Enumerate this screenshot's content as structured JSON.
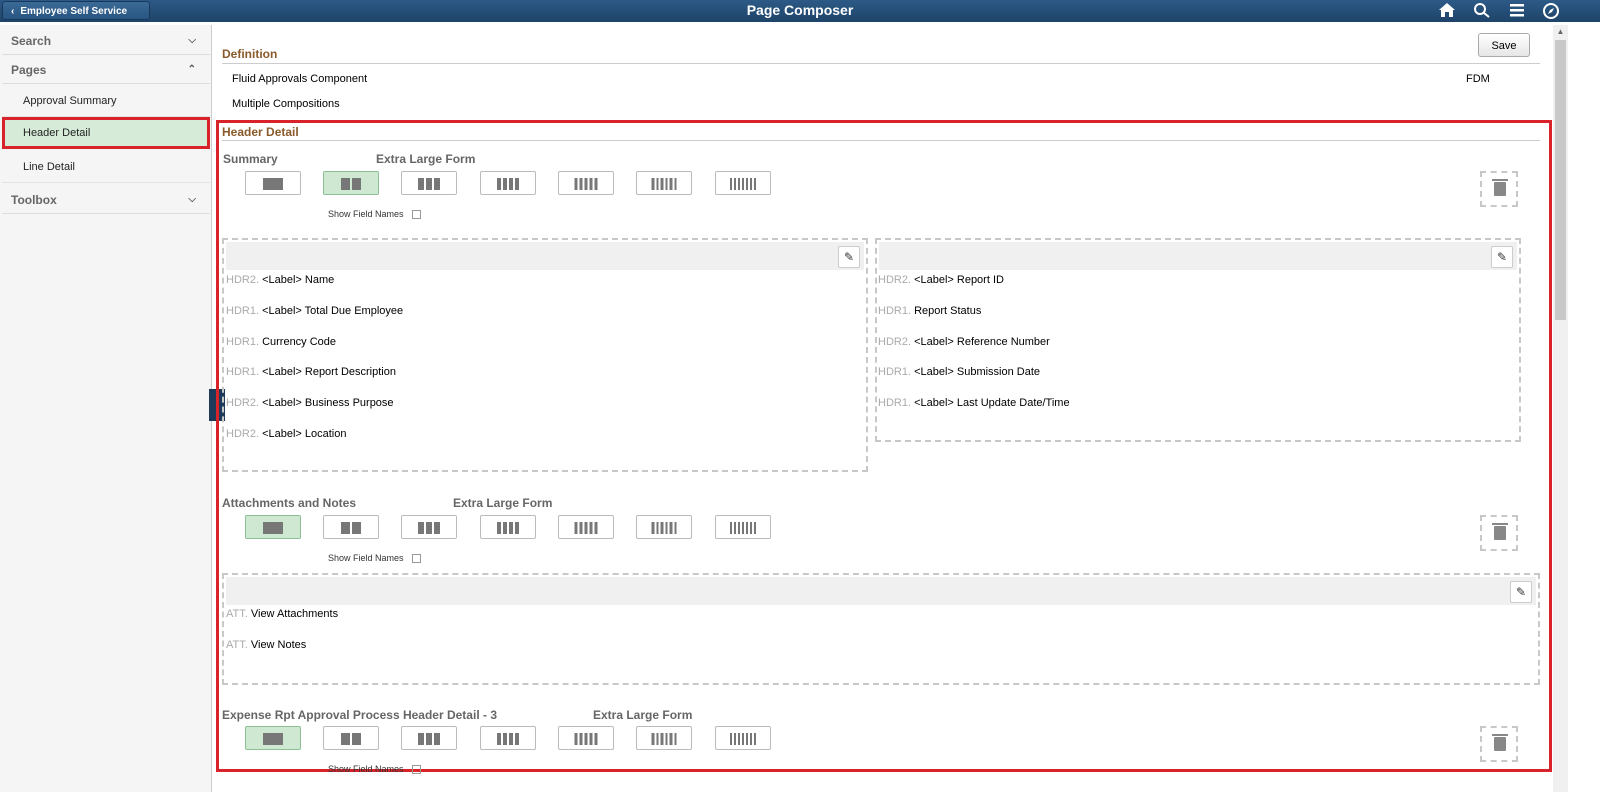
{
  "header": {
    "back_label": "Employee Self Service",
    "title": "Page Composer",
    "icons": [
      "home-icon",
      "search-icon",
      "menu-icon",
      "navigator-icon"
    ]
  },
  "sidebar": {
    "search_label": "Search",
    "pages_label": "Pages",
    "items": [
      {
        "label": "Approval Summary",
        "selected": false
      },
      {
        "label": "Header Detail",
        "selected": true
      },
      {
        "label": "Line Detail",
        "selected": false
      }
    ],
    "toolbox_label": "Toolbox"
  },
  "definition": {
    "title": "Definition",
    "component": "Fluid Approvals Component",
    "compositions": "Multiple Compositions",
    "code": "FDM",
    "save_label": "Save"
  },
  "header_detail": {
    "title": "Header Detail",
    "groups": [
      {
        "label": "Summary",
        "form_label": "Extra Large Form",
        "selected_layout": 2,
        "show_field_names": "Show Field Names",
        "columns": [
          {
            "fields": [
              {
                "prefix": "HDR2.",
                "text": "<Label> Name"
              },
              {
                "prefix": "HDR1.",
                "text": "<Label> Total Due Employee"
              },
              {
                "prefix": "HDR1.",
                "text": "Currency Code"
              },
              {
                "prefix": "HDR1.",
                "text": "<Label> Report Description"
              },
              {
                "prefix": "HDR2.",
                "text": "<Label> Business Purpose"
              },
              {
                "prefix": "HDR2.",
                "text": "<Label> Location"
              }
            ]
          },
          {
            "fields": [
              {
                "prefix": "HDR2.",
                "text": "<Label> Report ID"
              },
              {
                "prefix": "HDR1.",
                "text": "Report Status"
              },
              {
                "prefix": "HDR2.",
                "text": "<Label> Reference Number"
              },
              {
                "prefix": "HDR1.",
                "text": "<Label> Submission Date"
              },
              {
                "prefix": "HDR1.",
                "text": "<Label> Last Update Date/Time"
              }
            ]
          }
        ]
      },
      {
        "label": "Attachments and Notes",
        "form_label": "Extra Large Form",
        "selected_layout": 1,
        "show_field_names": "Show Field Names",
        "columns": [
          {
            "fields": [
              {
                "prefix": "ATT.",
                "text": "View Attachments"
              },
              {
                "prefix": "ATT.",
                "text": "View Notes"
              }
            ]
          }
        ]
      },
      {
        "label": "Expense Rpt Approval Process Header Detail - 3",
        "form_label": "Extra Large Form",
        "selected_layout": 1,
        "show_field_names": "Show Field Names"
      }
    ]
  }
}
